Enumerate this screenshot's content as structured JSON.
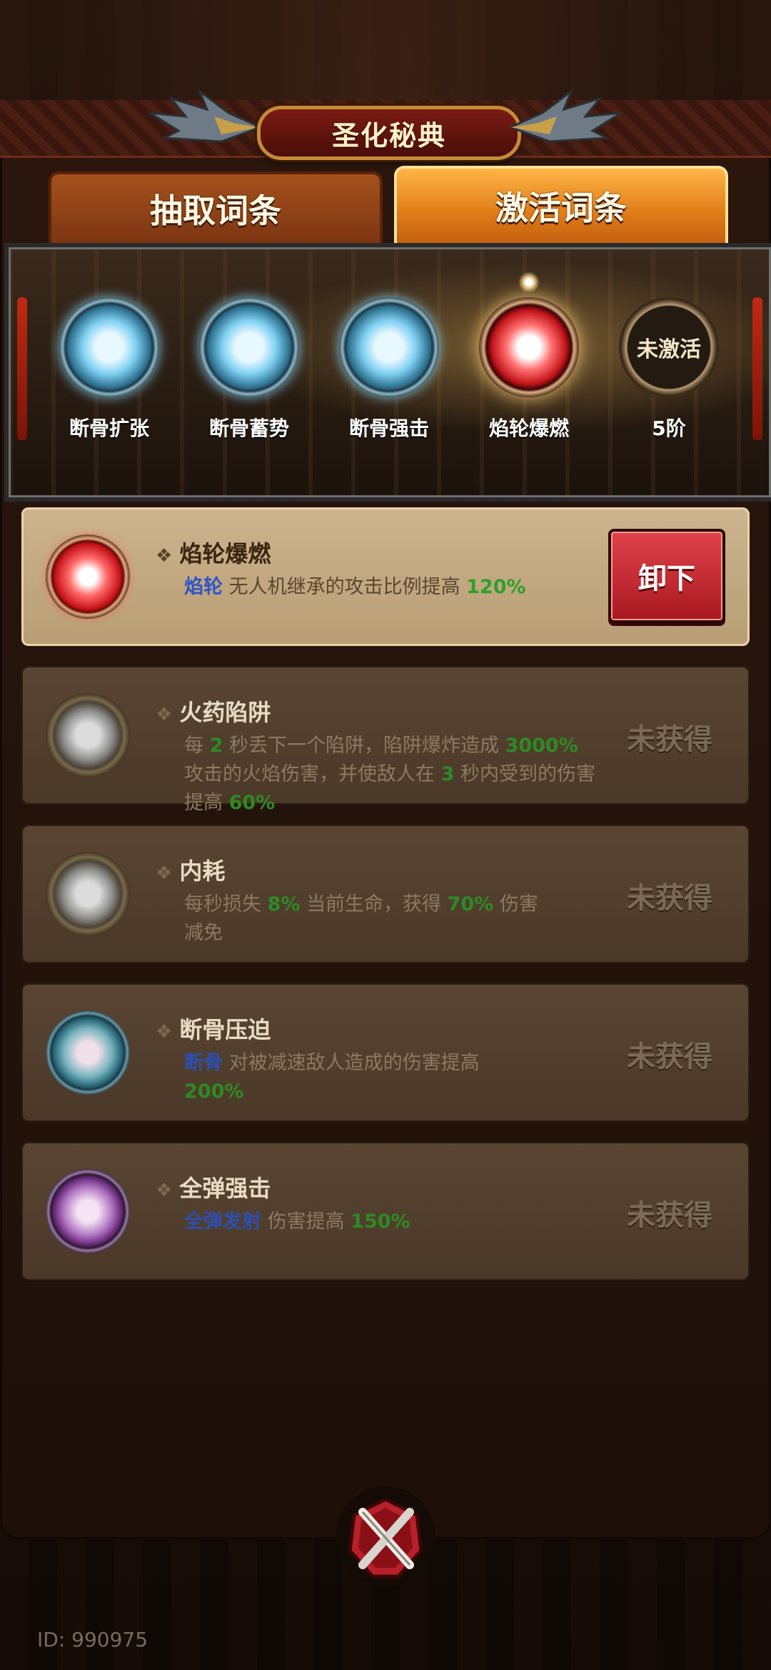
{
  "title": "圣化秘典",
  "tabs": [
    {
      "label": "抽取词条",
      "active": false
    },
    {
      "label": "激活词条",
      "active": true
    }
  ],
  "slots": [
    {
      "label": "断骨扩张",
      "orb": "blue"
    },
    {
      "label": "断骨蓄势",
      "orb": "blue"
    },
    {
      "label": "断骨强击",
      "orb": "blue"
    },
    {
      "label": "焰轮爆燃",
      "orb": "red",
      "selected": true
    },
    {
      "label": "5阶",
      "orb": "locked",
      "orb_text": "未激活"
    }
  ],
  "cards": [
    {
      "name": "焰轮爆燃",
      "orb": "red",
      "active": true,
      "button": "卸下",
      "desc_parts": [
        {
          "t": "焰轮",
          "s": "blue"
        },
        {
          "t": " 无人机继承的攻击比例提高 ",
          "s": ""
        },
        {
          "t": "120%",
          "s": "green"
        }
      ]
    },
    {
      "name": "火药陷阱",
      "orb": "grey",
      "active": false,
      "status": "未获得",
      "desc_parts": [
        {
          "t": "每 ",
          "s": ""
        },
        {
          "t": "2",
          "s": "green"
        },
        {
          "t": " 秒丢下一个陷阱，陷阱爆炸造成 ",
          "s": ""
        },
        {
          "t": "3000%",
          "s": "green"
        },
        {
          "t": " 攻击的火焰伤害，并使敌人在 ",
          "s": ""
        },
        {
          "t": "3",
          "s": "green"
        },
        {
          "t": " 秒内受到的伤害提高 ",
          "s": ""
        },
        {
          "t": "60%",
          "s": "green"
        }
      ]
    },
    {
      "name": "内耗",
      "orb": "grey",
      "active": false,
      "status": "未获得",
      "desc_parts": [
        {
          "t": "每秒损失 ",
          "s": ""
        },
        {
          "t": "8%",
          "s": "green"
        },
        {
          "t": " 当前生命，获得 ",
          "s": ""
        },
        {
          "t": "70%",
          "s": "green"
        },
        {
          "t": " 伤害减免",
          "s": ""
        }
      ]
    },
    {
      "name": "断骨压迫",
      "orb": "teal",
      "active": false,
      "status": "未获得",
      "desc_parts": [
        {
          "t": "断骨",
          "s": "blue"
        },
        {
          "t": " 对被减速敌人造成的伤害提高 ",
          "s": ""
        },
        {
          "t": "200%",
          "s": "green"
        }
      ]
    },
    {
      "name": "全弹强击",
      "orb": "purple",
      "active": false,
      "status": "未获得",
      "desc_parts": [
        {
          "t": "全弹发射",
          "s": "blue"
        },
        {
          "t": " 伤害提高 ",
          "s": ""
        },
        {
          "t": "150%",
          "s": "green"
        }
      ]
    }
  ],
  "close_icon": "crossed-swords-close-icon",
  "footer_id": "ID: 990975"
}
